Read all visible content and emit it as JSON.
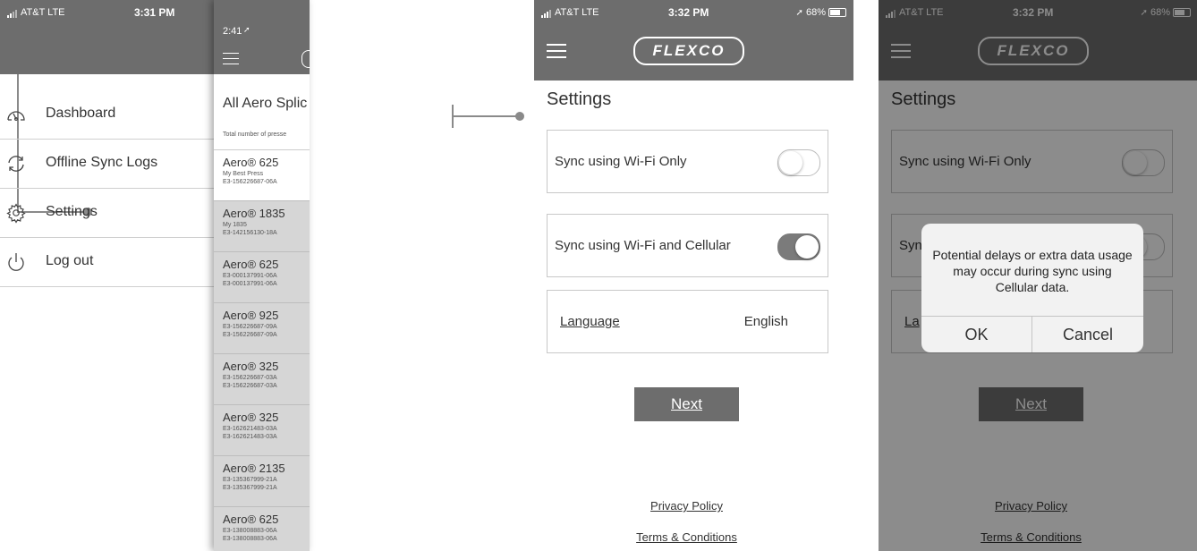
{
  "phone1": {
    "status": {
      "carrier": "AT&T  LTE",
      "time": "3:31 PM"
    },
    "menu": [
      {
        "label": "Dashboard",
        "icon": "dashboard-gauge-icon"
      },
      {
        "label": "Offline Sync Logs",
        "icon": "sync-icon"
      },
      {
        "label": "Settings",
        "icon": "gear-icon"
      },
      {
        "label": "Log out",
        "icon": "power-icon"
      }
    ],
    "list_overlay": {
      "time": "2:41",
      "title": "All Aero Splic",
      "subtitle": "Total number of presse",
      "rows": [
        {
          "name": "Aero® 625",
          "line1": "My Best Press",
          "line2": "E3-156226687-06A"
        },
        {
          "name": "Aero® 1835",
          "line1": "My 1835",
          "line2": "E3-142156130-18A"
        },
        {
          "name": "Aero® 625",
          "line1": "E3-000137991-06A",
          "line2": "E3-000137991-06A"
        },
        {
          "name": "Aero® 925",
          "line1": "E3-156226687-09A",
          "line2": "E3-156226687-09A"
        },
        {
          "name": "Aero® 325",
          "line1": "E3-156226687-03A",
          "line2": "E3-156226687-03A"
        },
        {
          "name": "Aero® 325",
          "line1": "E3-162621483-03A",
          "line2": "E3-162621483-03A"
        },
        {
          "name": "Aero® 2135",
          "line1": "E3-135367999-21A",
          "line2": "E3-135367999-21A"
        },
        {
          "name": "Aero® 625",
          "line1": "E3-138008883-06A",
          "line2": "E3-138008883-06A"
        }
      ]
    }
  },
  "phone2": {
    "status": {
      "carrier": "AT&T  LTE",
      "time": "3:32 PM",
      "battery": "68%"
    },
    "logo": "FLEXCO",
    "title": "Settings",
    "wifi_only": {
      "label": "Sync using Wi-Fi Only",
      "state": "off"
    },
    "wifi_cell": {
      "label": "Sync using Wi-Fi and Cellular",
      "state": "on"
    },
    "language": {
      "label": "Language",
      "value": "English"
    },
    "next": "Next",
    "privacy": "Privacy Policy",
    "terms": "Terms & Conditions"
  },
  "phone3": {
    "status": {
      "carrier": "AT&T  LTE",
      "time": "3:32 PM",
      "battery": "68%"
    },
    "logo": "FLEXCO",
    "title": "Settings",
    "wifi_only": {
      "label": "Sync using Wi-Fi Only"
    },
    "wifi_cell_partial": "Syn",
    "language_partial": "La",
    "next": "Next",
    "privacy": "Privacy Policy",
    "terms": "Terms & Conditions",
    "alert": {
      "message": "Potential delays or extra data usage may occur during sync using Cellular data.",
      "ok": "OK",
      "cancel": "Cancel"
    }
  },
  "colors": {
    "header": "#6d6d6d",
    "connector": "#8a8a8a",
    "toggle_on": "#7b7b7b"
  }
}
